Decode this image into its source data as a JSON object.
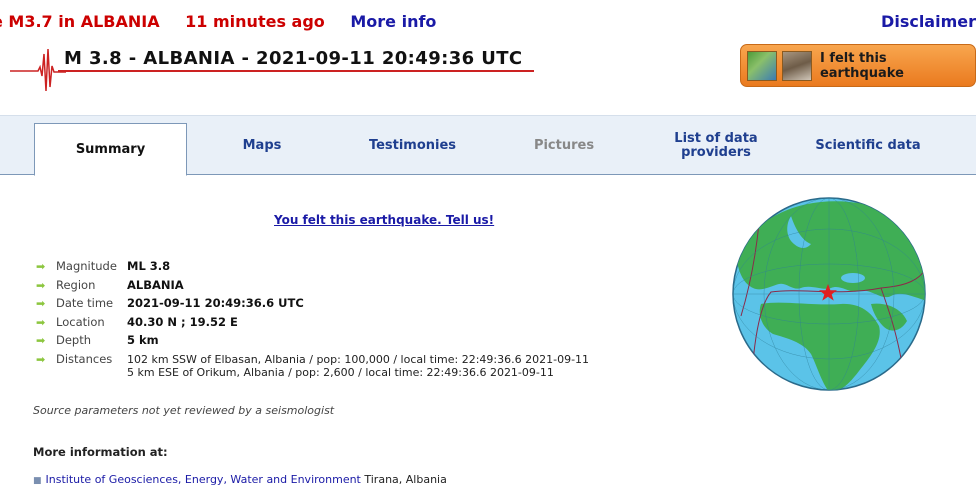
{
  "ticker": {
    "alert": "e M3.7 in ALBANIA",
    "ago": "11 minutes ago",
    "more_info": "More info",
    "disclaimer": "Disclaimer"
  },
  "header": {
    "title": "M 3.8 - ALBANIA - 2021-09-11 20:49:36 UTC",
    "felt_button": "I felt this earthquake"
  },
  "tabs": [
    {
      "label": "Summary",
      "state": "active"
    },
    {
      "label": "Maps",
      "state": "normal"
    },
    {
      "label": "Testimonies",
      "state": "normal"
    },
    {
      "label": "Pictures",
      "state": "disabled"
    },
    {
      "label": "List of data providers",
      "state": "normal"
    },
    {
      "label": "Scientific data",
      "state": "normal"
    }
  ],
  "felt_link": "You felt this earthquake. Tell us!",
  "details": {
    "magnitude": {
      "label": "Magnitude",
      "value": "ML 3.8"
    },
    "region": {
      "label": "Region",
      "value": "ALBANIA"
    },
    "datetime": {
      "label": "Date time",
      "value": "2021-09-11 20:49:36.6 UTC"
    },
    "location": {
      "label": "Location",
      "value": "40.30 N ; 19.52 E"
    },
    "depth": {
      "label": "Depth",
      "value": "5 km"
    },
    "distances": {
      "label": "Distances",
      "lines": [
        "102 km SSW of Elbasan, Albania / pop: 100,000 / local time: 22:49:36.6 2021-09-11",
        "5 km ESE of Orikum, Albania / pop: 2,600 / local time: 22:49:36.6 2021-09-11"
      ]
    }
  },
  "source_note": "Source parameters not yet reviewed by a seismologist",
  "more_info_heading": "More information at:",
  "institute": {
    "link": "Institute of Geosciences, Energy, Water and Environment",
    "location": " Tirana, Albania"
  },
  "colors": {
    "alert": "#cc0000",
    "link": "#1a1aa6",
    "ocean": "#5bc3e8",
    "land": "#3fae55",
    "epicenter": "#e02020",
    "button": "#f39b42"
  },
  "icons": {
    "arrow": "right-arrow-icon",
    "epicenter": "star-icon"
  }
}
